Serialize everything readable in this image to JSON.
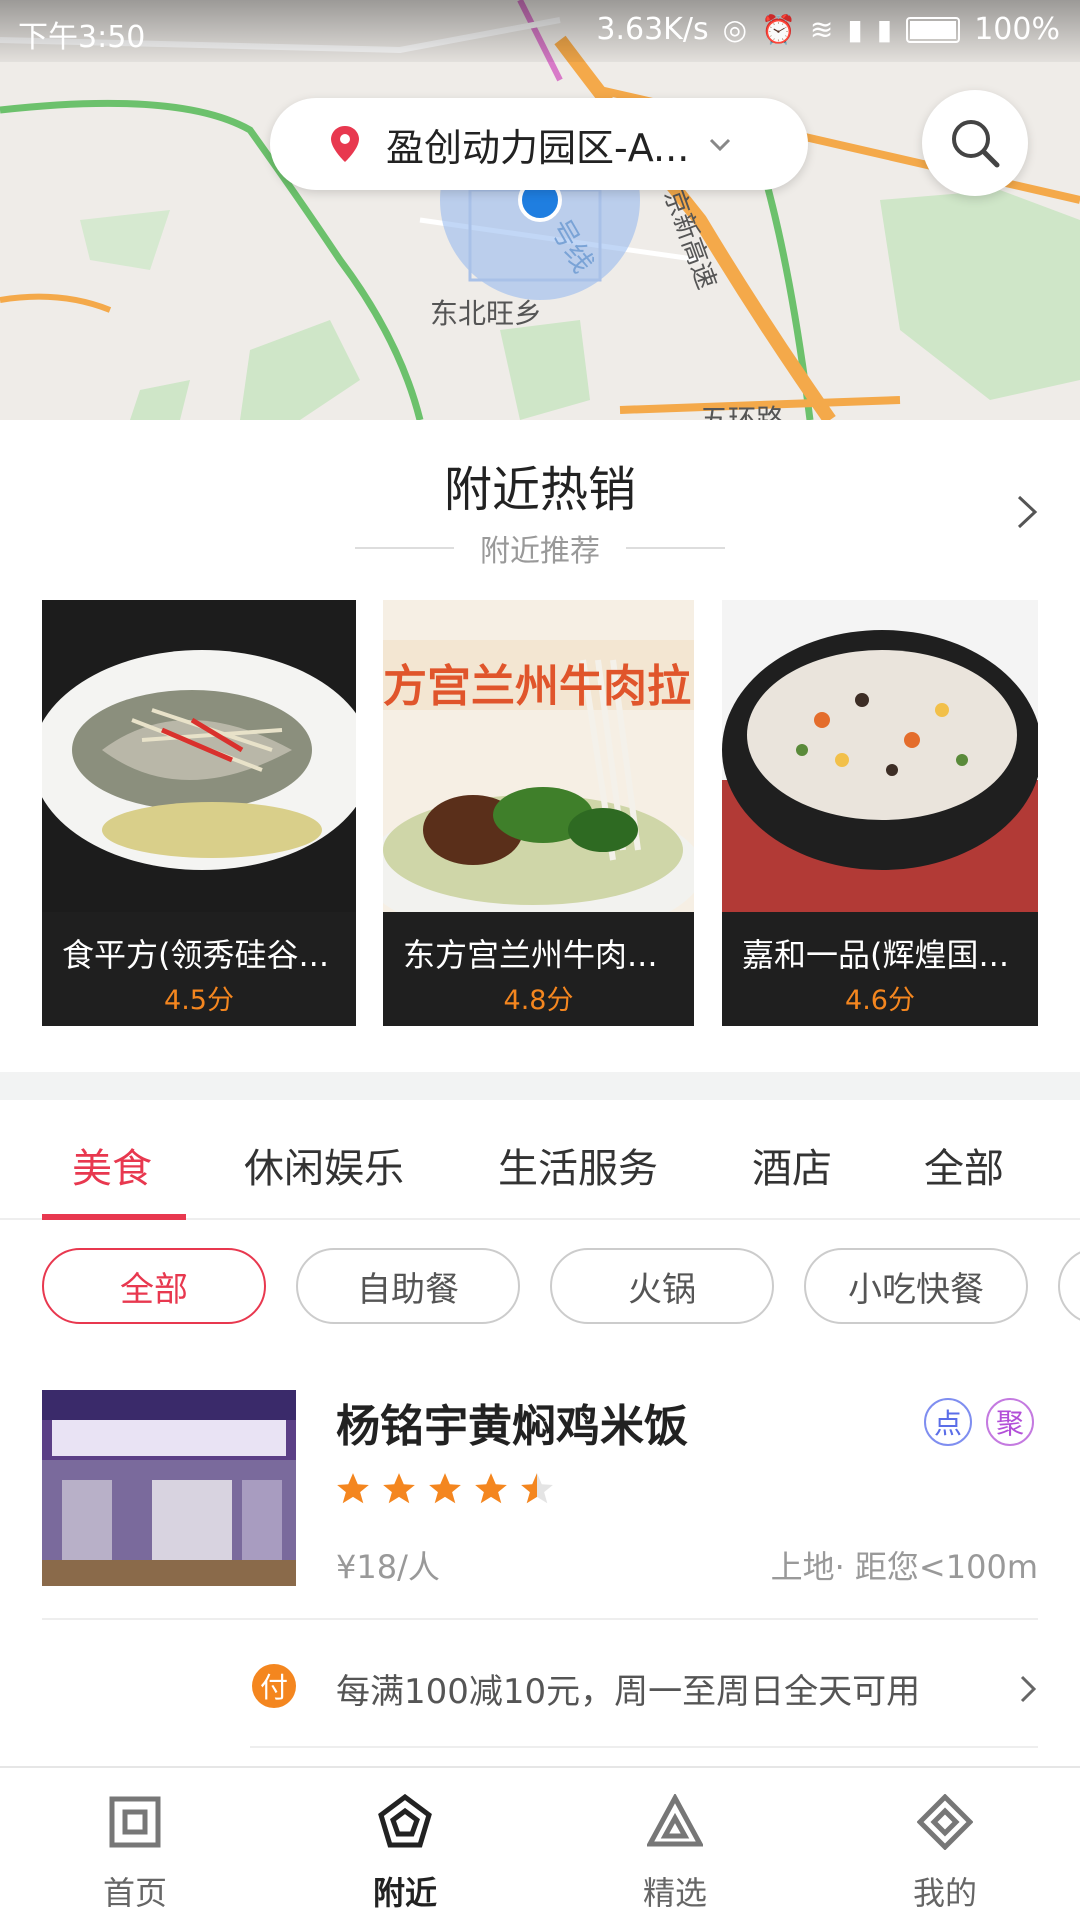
{
  "status_bar": {
    "time": "下午3:50",
    "net_speed": "3.63K/s",
    "battery": "100%"
  },
  "map": {
    "location_name": "盈创动力园区-A...",
    "labels": {
      "area": "东北旺乡",
      "line": "号线",
      "highway": "京新高速",
      "road": "五环路"
    },
    "icons": [
      "location-pin-icon",
      "chevron-down-icon",
      "search-icon",
      "user-location-icon"
    ]
  },
  "hot_nearby": {
    "title": "附近热销",
    "subtitle": "附近推荐",
    "cards": [
      {
        "name": "食平方(领秀硅谷...",
        "score": "4.5分"
      },
      {
        "name": "东方宫兰州牛肉...",
        "score": "4.8分",
        "photo_text": "方宫兰州牛肉拉"
      },
      {
        "name": "嘉和一品(辉煌国...",
        "score": "4.6分"
      }
    ]
  },
  "category_tabs": [
    "美食",
    "休闲娱乐",
    "生活服务",
    "酒店",
    "全部"
  ],
  "filter_chips": [
    "全部",
    "自助餐",
    "火锅",
    "小吃快餐"
  ],
  "shop": {
    "name": "杨铭宇黄焖鸡米饭",
    "badge_dian": "点",
    "badge_ju": "聚",
    "rating": 4.5,
    "price": "¥18/人",
    "distance": "上地· 距您<100m",
    "promo_icon": "付",
    "promo_text": "每满100减10元，周一至周日全天可用"
  },
  "bottom_nav": [
    "首页",
    "附近",
    "精选",
    "我的"
  ],
  "colors": {
    "accent": "#e8384f",
    "score": "#f4861f",
    "star": "#f4861f"
  }
}
